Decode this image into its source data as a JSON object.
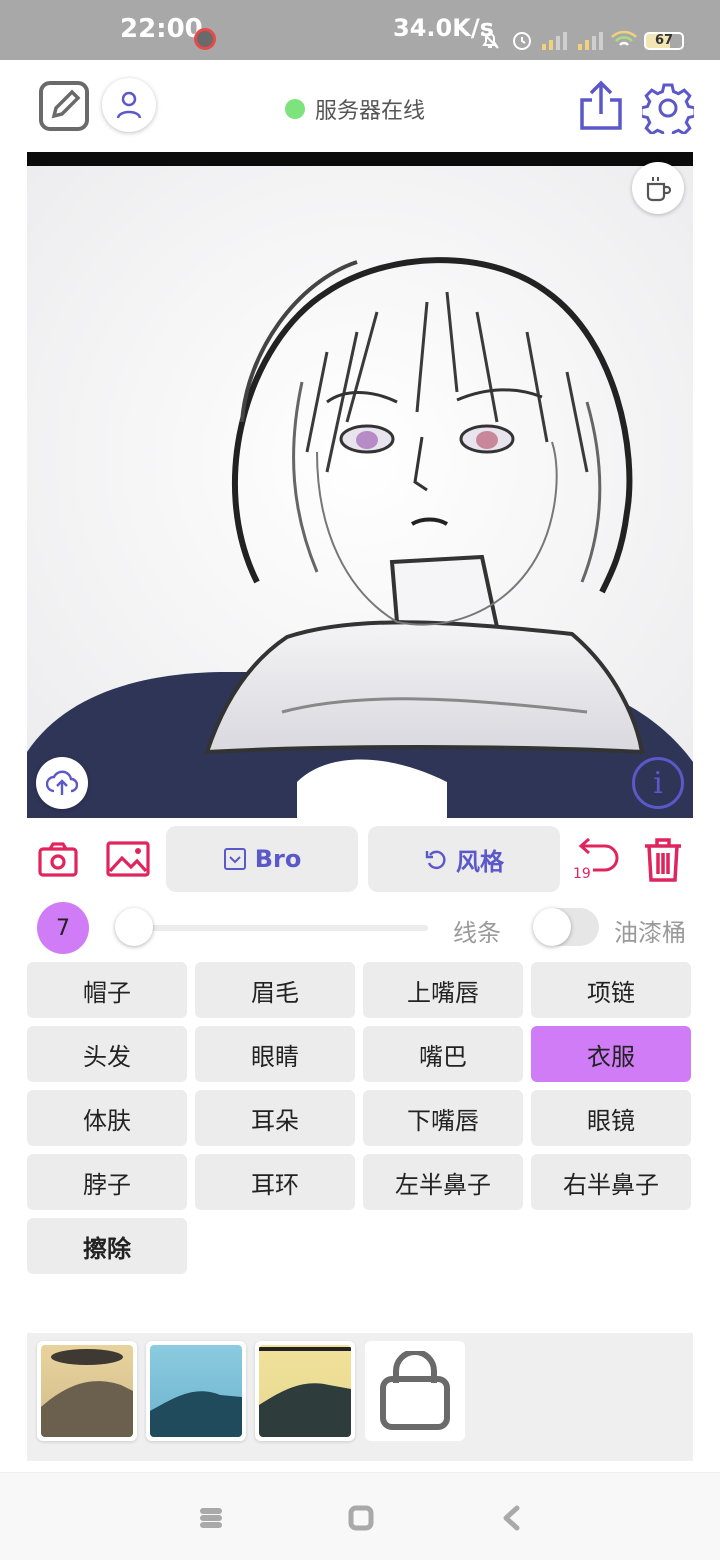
{
  "status_bar": {
    "time": "22:00",
    "net_speed": "34.0K/s",
    "battery": "67"
  },
  "header": {
    "server_status": "服务器在线",
    "server_status_color": "#7de47d"
  },
  "canvas": {
    "description_icons": [
      "coffee-icon",
      "upload-cloud-icon",
      "info-icon"
    ]
  },
  "toolbar": {
    "mask_button_label": "Bro",
    "style_button_label": "风格",
    "undo_count": "19",
    "accent_color": "#5b58c9",
    "danger_color": "#e0245e"
  },
  "brush": {
    "size": "7",
    "line_label": "线条",
    "bucket_label": "油漆桶",
    "size_slider_value": 0,
    "bucket_enabled": false
  },
  "segments": [
    {
      "label": "帽子",
      "active": false
    },
    {
      "label": "眉毛",
      "active": false
    },
    {
      "label": "上嘴唇",
      "active": false
    },
    {
      "label": "项链",
      "active": false
    },
    {
      "label": "头发",
      "active": false
    },
    {
      "label": "眼睛",
      "active": false
    },
    {
      "label": "嘴巴",
      "active": false
    },
    {
      "label": "衣服",
      "active": true
    },
    {
      "label": "体肤",
      "active": false
    },
    {
      "label": "耳朵",
      "active": false
    },
    {
      "label": "下嘴唇",
      "active": false
    },
    {
      "label": "眼镜",
      "active": false
    },
    {
      "label": "脖子",
      "active": false
    },
    {
      "label": "耳环",
      "active": false
    },
    {
      "label": "左半鼻子",
      "active": false
    },
    {
      "label": "右半鼻子",
      "active": false
    },
    {
      "label": "擦除",
      "active": false
    }
  ],
  "active_color": "#cf7cf6"
}
